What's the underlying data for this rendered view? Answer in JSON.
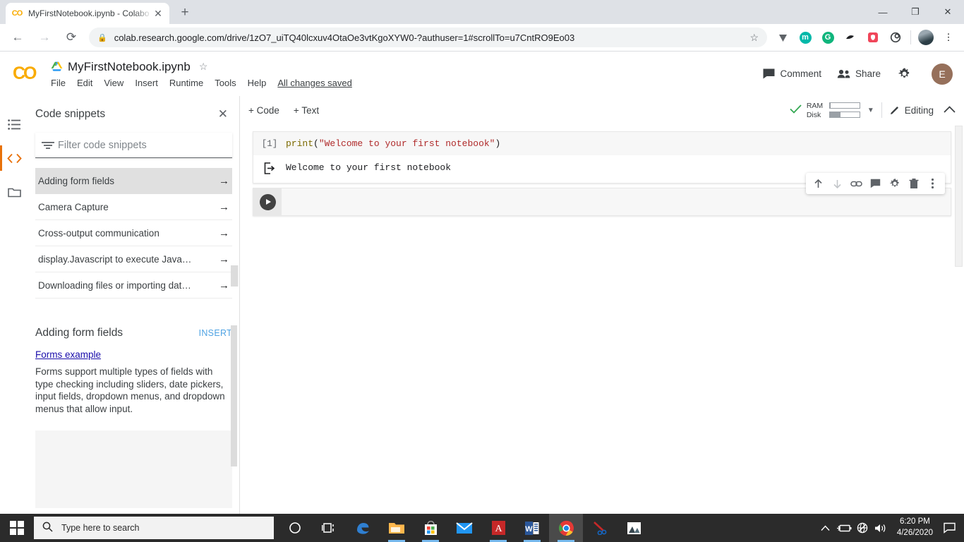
{
  "browser": {
    "tab": {
      "favicon": "colab-favicon",
      "title": "MyFirstNotebook.ipynb - Colabo",
      "close_label": "✕"
    },
    "new_tab_label": "+",
    "window_controls": {
      "minimize": "—",
      "maximize": "❐",
      "close": "✕"
    },
    "nav": {
      "back": "←",
      "forward": "→",
      "reload": "⟳"
    },
    "omnibox": {
      "lock_icon": "lock-icon",
      "url": "colab.research.google.com/drive/1zO7_uiTQ40lcxuv4OtaOe3vtKgoXYW0-?authuser=1#scrollTo=u7CntRO9Eo03",
      "star_icon": "☆"
    },
    "extensions": [
      {
        "name": "v-extension-icon",
        "glyph": "▼",
        "color": "#5f6368"
      },
      {
        "name": "m-extension-icon",
        "glyph": "m",
        "color": "#00b8a9"
      },
      {
        "name": "g-extension-icon",
        "glyph": "G",
        "color": "#0fb57c"
      },
      {
        "name": "dark-extension-icon",
        "glyph": "❤",
        "color": "#202124"
      },
      {
        "name": "shield-extension-icon",
        "glyph": "⛉",
        "color": "#f44336"
      },
      {
        "name": "loop-extension-icon",
        "glyph": "◎",
        "color": "#3c4043"
      }
    ],
    "profile_avatar": "profile-avatar",
    "menu_icon": "⋮"
  },
  "colab": {
    "logo_text": "CO",
    "drive_icon": "google-drive-icon",
    "notebook_title": "MyFirstNotebook.ipynb",
    "star_icon": "☆",
    "menus": [
      "File",
      "Edit",
      "View",
      "Insert",
      "Runtime",
      "Tools",
      "Help"
    ],
    "save_status": "All changes saved",
    "header_actions": [
      {
        "label": "Comment",
        "icon": "comment-icon"
      },
      {
        "label": "Share",
        "icon": "people-icon"
      }
    ],
    "settings_icon": "gear-icon",
    "account_initial": "E"
  },
  "rail": [
    {
      "name": "table-of-contents-icon",
      "active": false
    },
    {
      "name": "code-snippets-icon",
      "active": true
    },
    {
      "name": "files-icon",
      "active": false
    }
  ],
  "snippets_panel": {
    "title": "Code snippets",
    "close_icon": "✕",
    "filter": {
      "placeholder": "Filter code snippets",
      "value": "",
      "icon": "filter-icon"
    },
    "items": [
      {
        "label": "Adding form fields",
        "selected": true
      },
      {
        "label": "Camera Capture",
        "selected": false
      },
      {
        "label": "Cross-output communication",
        "selected": false
      },
      {
        "label": "display.Javascript to execute Java…",
        "selected": false
      },
      {
        "label": "Downloading files or importing dat…",
        "selected": false
      }
    ],
    "arrow_glyph": "→",
    "detail": {
      "title": "Adding form fields",
      "insert_label": "INSERT",
      "link_text": "Forms example",
      "body": "Forms support multiple types of fields with type checking including sliders, date pickers, input fields, dropdown menus, and dropdown menus that allow input."
    }
  },
  "notebook_toolbar": {
    "add_code_label": "+ Code",
    "add_text_label": "+ Text",
    "connected_icon": "checkmark-icon",
    "resources": [
      {
        "label": "RAM",
        "fill_percent": 4
      },
      {
        "label": "Disk",
        "fill_percent": 35
      }
    ],
    "dropdown_caret": "▼",
    "editing_label": "Editing",
    "pencil_icon": "pencil-icon",
    "collapse_icon": "⌃"
  },
  "cells": [
    {
      "type": "code",
      "exec_count": "[1]",
      "source_tokens": [
        {
          "text": "print",
          "kind": "function"
        },
        {
          "text": "(",
          "kind": "punct"
        },
        {
          "text": "\"Welcome to your first notebook\"",
          "kind": "string"
        },
        {
          "text": ")",
          "kind": "punct"
        }
      ],
      "output_icon": "output-arrow-icon",
      "output_text": "Welcome to your first notebook"
    },
    {
      "type": "code-empty",
      "run_icon": "run-cell-icon",
      "source": ""
    }
  ],
  "cell_actions": [
    {
      "name": "move-cell-up-button",
      "glyph": "↑",
      "faded": false
    },
    {
      "name": "move-cell-down-button",
      "glyph": "↓",
      "faded": true
    },
    {
      "name": "link-to-cell-button",
      "glyph": "⚭",
      "faded": false
    },
    {
      "name": "add-comment-button",
      "glyph": "▤",
      "faded": false
    },
    {
      "name": "cell-settings-button",
      "glyph": "⚙",
      "faded": false
    },
    {
      "name": "delete-cell-button",
      "glyph": "Ὕ1",
      "faded": false
    },
    {
      "name": "more-cell-actions-button",
      "glyph": "⋮",
      "faded": false
    }
  ],
  "taskbar": {
    "start_icon": "windows-logo-icon",
    "search": {
      "placeholder": "Type here to search",
      "icon": "search-icon"
    },
    "items": [
      {
        "name": "cortana-icon",
        "glyph": "○",
        "running": false
      },
      {
        "name": "task-view-icon",
        "glyph": "⌸",
        "running": false
      },
      {
        "name": "edge-icon",
        "glyph": "e",
        "running": false
      },
      {
        "name": "file-explorer-icon",
        "glyph": "▤",
        "running": true
      },
      {
        "name": "microsoft-store-icon",
        "glyph": "⊞",
        "running": true
      },
      {
        "name": "mail-icon",
        "glyph": "✉",
        "running": false
      },
      {
        "name": "adobe-reader-icon",
        "glyph": "A",
        "running": true
      },
      {
        "name": "word-icon",
        "glyph": "W",
        "running": true
      },
      {
        "name": "chrome-icon",
        "glyph": "●",
        "running": true,
        "active": true
      },
      {
        "name": "snipping-tool-icon",
        "glyph": "✂",
        "running": false
      },
      {
        "name": "photos-icon",
        "glyph": "⛰",
        "running": false
      }
    ],
    "tray": [
      {
        "name": "show-hidden-icons-button",
        "glyph": "⌃"
      },
      {
        "name": "battery-icon",
        "glyph": "▭"
      },
      {
        "name": "network-icon",
        "glyph": "⊕"
      },
      {
        "name": "volume-icon",
        "glyph": "▶"
      }
    ],
    "clock": {
      "time": "6:20 PM",
      "date": "4/26/2020"
    },
    "action_center_icon": "notifications-icon"
  }
}
